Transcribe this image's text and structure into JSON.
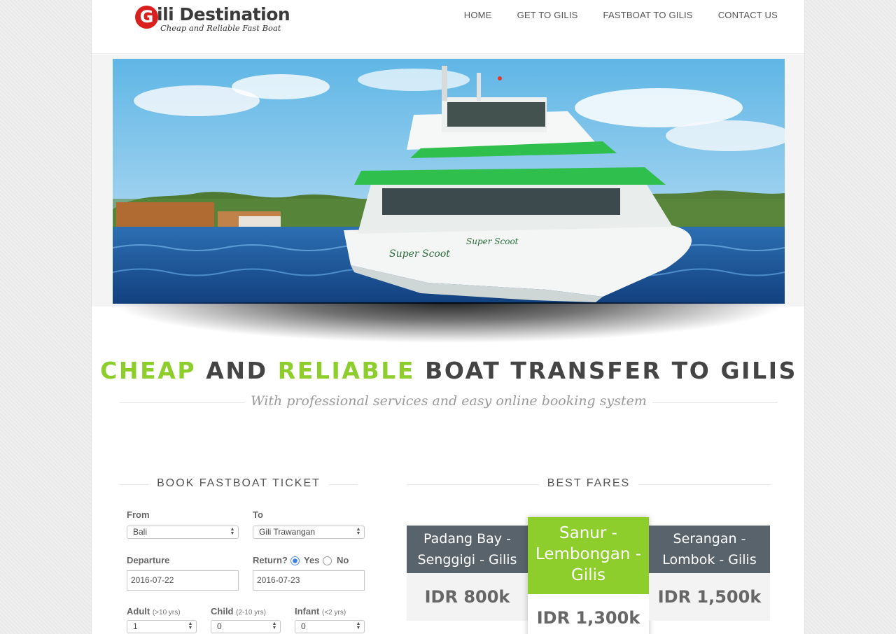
{
  "brand": {
    "logo_letter": "G",
    "name": "ili Destination",
    "tagline": "Cheap and Reliable Fast Boat"
  },
  "nav": {
    "items": [
      {
        "label": "HOME"
      },
      {
        "label": "GET TO GILIS"
      },
      {
        "label": "FASTBOAT TO GILIS"
      },
      {
        "label": "CONTACT US"
      }
    ]
  },
  "hero": {
    "boat_name": "Super Scoot"
  },
  "headline": {
    "word1": "CHEAP",
    "word2": " AND ",
    "word3": "RELIABLE",
    "word4": " BOAT TRANSFER TO GILIS",
    "subtitle": "With professional services and easy online booking system",
    "accent_color": "#8dcd2c"
  },
  "booking": {
    "title": "BOOK FASTBOAT TICKET",
    "from_label": "From",
    "from_value": "Bali",
    "to_label": "To",
    "to_value": "Gili Trawangan",
    "departure_label": "Departure",
    "departure_value": "2016-07-22",
    "return_label": "Return?",
    "return_yes": "Yes",
    "return_no": "No",
    "return_selected": "Yes",
    "return_value": "2016-07-23",
    "adult_label": "Adult",
    "adult_hint": "(>10 yrs)",
    "adult_value": "1",
    "child_label": "Child",
    "child_hint": "(2-10 yrs)",
    "child_value": "0",
    "infant_label": "Infant",
    "infant_hint": "(<2 yrs)",
    "infant_value": "0"
  },
  "fares": {
    "title": "BEST FARES",
    "items": [
      {
        "route_line1": "Padang Bay -",
        "route_line2": "Senggigi - Gilis",
        "route_line3": "",
        "price": "IDR 800k"
      },
      {
        "route_line1": "Sanur -",
        "route_line2": "Lembongan -",
        "route_line3": "Gilis",
        "price": "IDR 1,300k",
        "featured": true
      },
      {
        "route_line1": "Serangan -",
        "route_line2": "Lombok - Gilis",
        "route_line3": "",
        "price": "IDR 1,500k"
      }
    ],
    "head_color": "#58636b",
    "featured_color": "#8dcd2c"
  }
}
